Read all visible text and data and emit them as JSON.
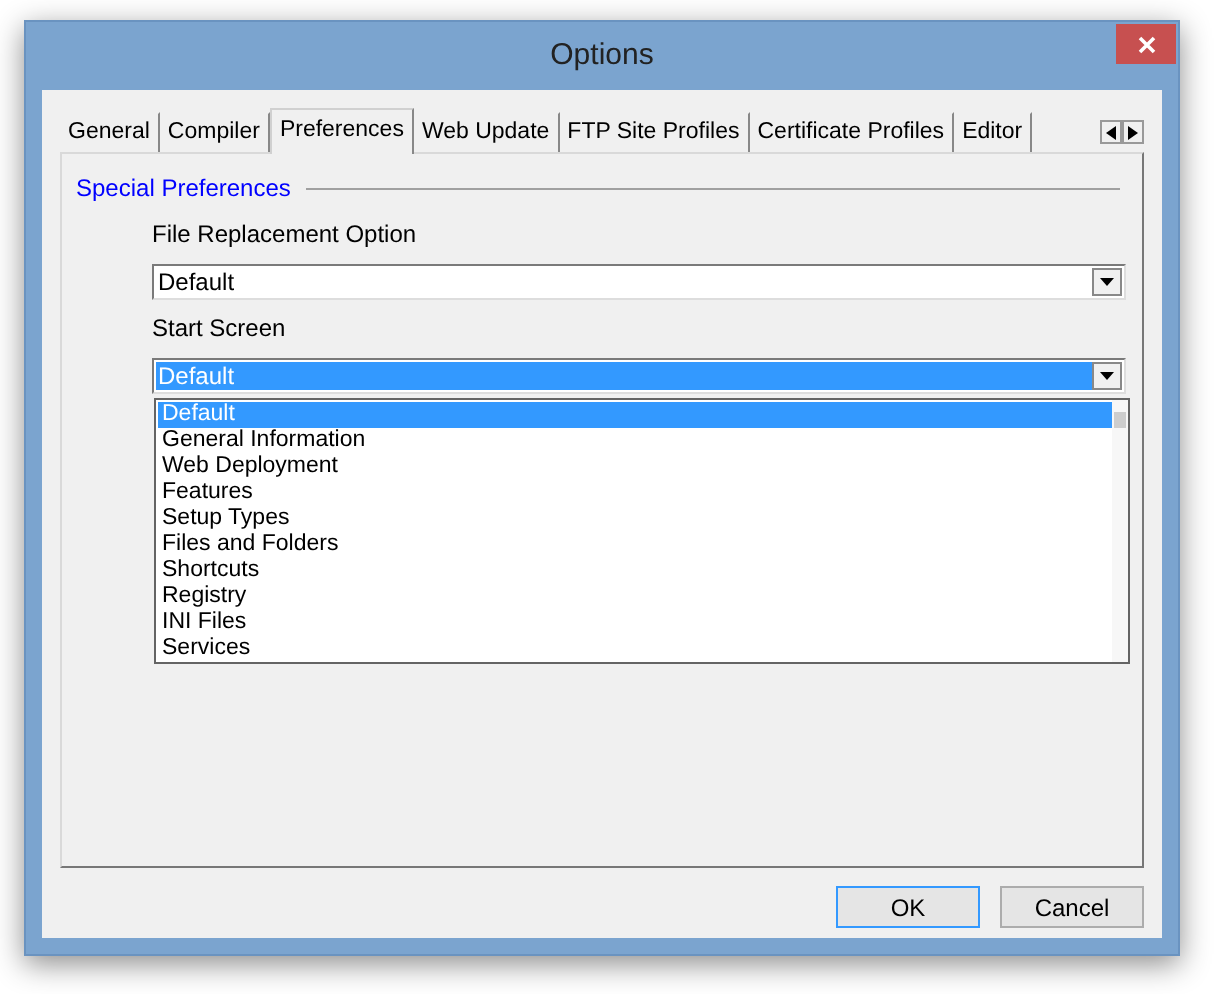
{
  "window": {
    "title": "Options"
  },
  "tabs": [
    {
      "label": "General",
      "selected": false
    },
    {
      "label": "Compiler",
      "selected": false
    },
    {
      "label": "Preferences",
      "selected": true
    },
    {
      "label": "Web Update",
      "selected": false
    },
    {
      "label": "FTP Site Profiles",
      "selected": false
    },
    {
      "label": "Certificate Profiles",
      "selected": false
    },
    {
      "label": "Editor",
      "selected": false
    }
  ],
  "group": {
    "title": "Special Preferences"
  },
  "fields": [
    {
      "label": "File Replacement Option",
      "value": "Default",
      "open": false
    },
    {
      "label": "Start Screen",
      "value": "Default",
      "open": true
    }
  ],
  "dropdown_list": [
    {
      "label": "Default",
      "selected": true
    },
    {
      "label": "General Information",
      "selected": false
    },
    {
      "label": "Web Deployment",
      "selected": false
    },
    {
      "label": "Features",
      "selected": false
    },
    {
      "label": "Setup Types",
      "selected": false
    },
    {
      "label": "Files and Folders",
      "selected": false
    },
    {
      "label": "Shortcuts",
      "selected": false
    },
    {
      "label": "Registry",
      "selected": false
    },
    {
      "label": "INI Files",
      "selected": false
    },
    {
      "label": "Services",
      "selected": false
    }
  ],
  "buttons": [
    {
      "label": "OK",
      "default": true
    },
    {
      "label": "Cancel",
      "default": false
    }
  ]
}
